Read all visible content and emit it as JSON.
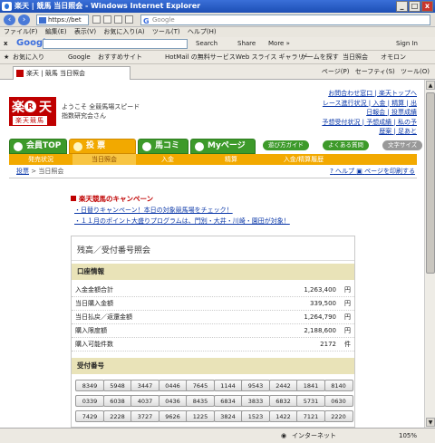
{
  "window": {
    "title": "楽天 | 競馬 当日照会 - Windows Internet Explorer",
    "buttons": [
      "_",
      "□",
      "x"
    ]
  },
  "address": {
    "url": "https://bet",
    "search_placeholder": "Google"
  },
  "menu": [
    "ファイル(F)",
    "編集(E)",
    "表示(V)",
    "お気に入り(A)",
    "ツール(T)",
    "ヘルプ(H)"
  ],
  "google_bar": {
    "logo": "Google",
    "search_btn": "Search",
    "share_btn": "Share",
    "more_btn": "More »",
    "signin": "Sign In"
  },
  "favorites": {
    "label": "お気に入り",
    "items": [
      "Google",
      "おすすめサイト",
      "HotMail の無料サービス",
      "Web スライス ギャラリー",
      "ゲームを探す",
      "当日照会",
      "オモロン"
    ]
  },
  "tab": {
    "label": "楽天 | 競馬 当日照会",
    "commands": [
      "ページ(P)",
      "セーフティ(S)",
      "ツール(O)"
    ]
  },
  "site": {
    "logo": {
      "top_a": "楽",
      "top_r": "R",
      "top_b": "天",
      "bottom": "楽天競馬"
    },
    "welcome_lines": [
      "ようこそ 全競馬場スピード",
      "指数研究会さん"
    ],
    "top_links": [
      "お問合わせ窓口",
      "楽天トップへ",
      "レース進行状況",
      "入金",
      "精算",
      "出",
      "日報会",
      "投票成績",
      "予想受付状況",
      "予想成績",
      "私の予",
      "歴案",
      "足あと"
    ],
    "nav_tabs": [
      "会員TOP",
      "投 票",
      "馬コミ",
      "Myページ"
    ],
    "nav_buttons": [
      "遊び方ガイド",
      "よくある質問",
      "文字サイズ"
    ],
    "sub_nav": [
      "発売状況",
      "当日照会",
      "入金",
      "精算",
      "入金/精算履歴"
    ],
    "breadcrumb": {
      "link": "投票",
      "current": "当日照会"
    },
    "help_links": [
      "ヘルプ",
      "ページを印刷する"
    ]
  },
  "campaign": {
    "title": "楽天競馬のキャンペーン",
    "items": [
      "・日替りキャンペーン！本日の対象競馬場をチェック！",
      "・１１月のポイント大盛りプログラムは、門別・大井・川崎・園田が対象！"
    ]
  },
  "panel": {
    "title": "残高／受付番号照会",
    "account_header": "口座情報",
    "rows": [
      {
        "label": "入金金額合計",
        "value": "1,263,400",
        "unit": "円"
      },
      {
        "label": "当日購入金額",
        "value": "339,500",
        "unit": "円"
      },
      {
        "label": "当日払戻／返還金額",
        "value": "1,264,790",
        "unit": "円"
      },
      {
        "label": "購入限度額",
        "value": "2,188,600",
        "unit": "円"
      },
      {
        "label": "購入可能件数",
        "value": "2172",
        "unit": "件"
      }
    ],
    "receipt_header": "受付番号",
    "receipt_numbers": [
      [
        "8349",
        "5948",
        "3447",
        "0446",
        "7645",
        "1144",
        "9543",
        "2442",
        "1841",
        "8140"
      ],
      [
        "0339",
        "6038",
        "4037",
        "0436",
        "8435",
        "6834",
        "3833",
        "6832",
        "5731",
        "0630"
      ],
      [
        "7429",
        "2228",
        "3727",
        "9626",
        "1225",
        "3824",
        "1523",
        "1422",
        "7121",
        "2220"
      ]
    ]
  },
  "status": {
    "zone": "インターネット",
    "zoom": "105%"
  }
}
